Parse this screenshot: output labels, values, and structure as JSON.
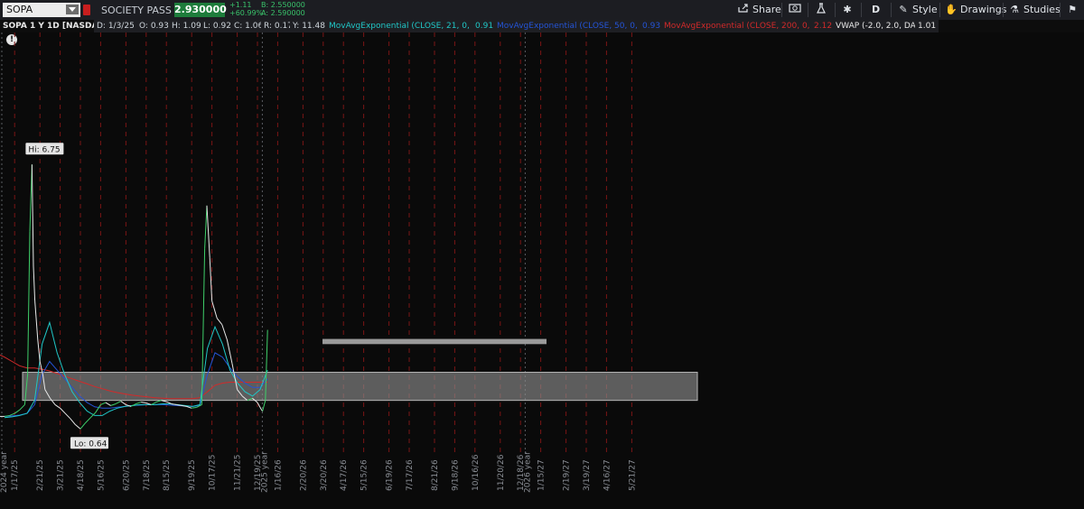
{
  "toolbar": {
    "symbol": "SOPA",
    "company": "SOCIETY PASS INC",
    "price": "2.930000",
    "change": "+1.11",
    "change_pct": "+60.99%",
    "bid": "B: 2.550000",
    "ask": "A: 2.590000",
    "share_label": "Share",
    "period_label": "D",
    "style_label": "Style",
    "drawings_label": "Drawings",
    "studies_label": "Studies",
    "accent_green": "#1d7c3b",
    "icons": [
      "share-icon",
      "camera-icon",
      "flask-icon",
      "gear-icon",
      "pencil-icon",
      "drawings-icon",
      "studies-icon",
      "pin-icon"
    ]
  },
  "status": {
    "title": "SOPA 1 Y 1D [NASDAQ]",
    "date": "D: 1/3/25",
    "open": "O: 0.93",
    "high": "H: 1.09",
    "low": "L: 0.92",
    "close": "C: 1.06",
    "range": "R: 0.17",
    "y": "Y: 11.48",
    "ema21_label": "MovAvgExponential (CLOSE, 21, 0, no)",
    "ema21_value": "0.91",
    "ema50_label": "MovAvgExponential (CLOSE, 50, 0, no)",
    "ema50_value": "0.93",
    "ema200_label": "MovAvgExponential (CLOSE, 200, 0, no)",
    "ema200_value": "2.12",
    "vwap_label": "VWAP (-2.0, 2.0, DAY)",
    "vwap_value": "1.01",
    "ema21_color": "#20c7c7",
    "ema50_color": "#2454d6",
    "ema200_color": "#d22a2a"
  },
  "chart_data": {
    "type": "line",
    "hi_label": "Hi: 6.75",
    "lo_label": "Lo: 0.64",
    "x_ticks": [
      "1/17/25",
      "2/21/25",
      "3/21/25",
      "4/18/25",
      "5/16/25",
      "6/20/25",
      "7/18/25",
      "8/15/25",
      "9/19/25",
      "10/17/25",
      "11/21/25",
      "12/19/25",
      "1/16/26",
      "2/20/26",
      "3/20/26",
      "4/17/26",
      "5/15/26",
      "6/19/26",
      "7/17/26",
      "8/21/26",
      "9/18/26",
      "10/16/26",
      "11/20/26",
      "12/18/26",
      "1/15/27",
      "2/19/27",
      "3/19/27",
      "4/16/27",
      "5/21/27"
    ],
    "year_markers": [
      "2024 year",
      "2025 year",
      "2026 year"
    ],
    "ylim": [
      0,
      9.8
    ],
    "price_series": {
      "name": "SOPA",
      "x": [
        "1/3/25",
        "1/10/25",
        "1/17/25",
        "1/24/25",
        "1/31/25",
        "2/4/25",
        "2/7/25",
        "2/10/25",
        "2/12/25",
        "2/14/25",
        "2/18/25",
        "2/21/25",
        "2/25/25",
        "2/28/25",
        "3/7/25",
        "3/14/25",
        "3/21/25",
        "3/28/25",
        "4/4/25",
        "4/11/25",
        "4/18/25",
        "4/25/25",
        "5/2/25",
        "5/9/25",
        "5/16/25",
        "5/23/25",
        "5/30/25",
        "6/6/25",
        "6/13/25",
        "6/20/25",
        "6/27/25",
        "7/4/25",
        "7/11/25",
        "7/18/25",
        "7/25/25",
        "8/1/25",
        "8/8/25",
        "8/15/25",
        "8/22/25",
        "8/29/25",
        "9/5/25",
        "9/12/25",
        "9/19/25",
        "9/26/25",
        "10/3/25",
        "10/7/25",
        "10/10/25",
        "10/14/25",
        "10/17/25",
        "10/24/25",
        "10/31/25",
        "11/7/25",
        "11/14/25",
        "11/21/25",
        "11/28/25",
        "12/5/25",
        "12/12/25",
        "12/19/25",
        "12/24/25",
        "12/26/25",
        "12/30/25",
        "1/2/26"
      ],
      "values": [
        0.93,
        0.95,
        1.0,
        1.08,
        1.2,
        1.9,
        5.2,
        6.75,
        4.4,
        3.6,
        2.7,
        2.2,
        1.9,
        1.55,
        1.35,
        1.2,
        1.12,
        1.0,
        0.88,
        0.74,
        0.64,
        0.78,
        0.9,
        1.02,
        1.2,
        1.25,
        1.18,
        1.22,
        1.28,
        1.2,
        1.16,
        1.22,
        1.26,
        1.24,
        1.2,
        1.26,
        1.3,
        1.27,
        1.22,
        1.2,
        1.18,
        1.16,
        1.12,
        1.14,
        1.2,
        4.8,
        5.8,
        4.6,
        3.6,
        3.2,
        3.05,
        2.7,
        2.15,
        1.55,
        1.4,
        1.3,
        1.35,
        1.25,
        1.1,
        1.05,
        1.3,
        2.93
      ]
    },
    "ema21": [
      0.9,
      0.92,
      0.95,
      1.0,
      1.3,
      2.6,
      3.1,
      2.4,
      1.9,
      1.5,
      1.25,
      1.05,
      0.95,
      0.95,
      1.05,
      1.12,
      1.16,
      1.18,
      1.2,
      1.2,
      1.2,
      1.22,
      1.22,
      1.2,
      1.18,
      1.16,
      1.2,
      2.5,
      3.0,
      2.6,
      2.0,
      1.7,
      1.5,
      1.4,
      1.55,
      2.0
    ],
    "ema50": [
      0.93,
      0.94,
      0.96,
      1.0,
      1.2,
      1.9,
      2.2,
      2.0,
      1.8,
      1.6,
      1.4,
      1.25,
      1.15,
      1.12,
      1.12,
      1.14,
      1.16,
      1.18,
      1.19,
      1.2,
      1.2,
      1.2,
      1.19,
      1.18,
      1.17,
      1.16,
      1.18,
      1.9,
      2.4,
      2.3,
      2.05,
      1.85,
      1.7,
      1.6,
      1.6,
      1.8
    ],
    "ema200": [
      2.3,
      2.2,
      2.1,
      2.05,
      2.05,
      2.02,
      1.98,
      1.92,
      1.86,
      1.8,
      1.74,
      1.68,
      1.62,
      1.57,
      1.52,
      1.48,
      1.45,
      1.42,
      1.4,
      1.38,
      1.36,
      1.35,
      1.34,
      1.34,
      1.34,
      1.34,
      1.36,
      1.5,
      1.65,
      1.7,
      1.72,
      1.72,
      1.72,
      1.72,
      1.72,
      1.72
    ],
    "zones": [
      {
        "name": "support-zone",
        "y_low": 1.3,
        "y_high": 1.95
      },
      {
        "name": "resistance-line",
        "y_low": 2.6,
        "y_high": 2.72
      }
    ]
  }
}
